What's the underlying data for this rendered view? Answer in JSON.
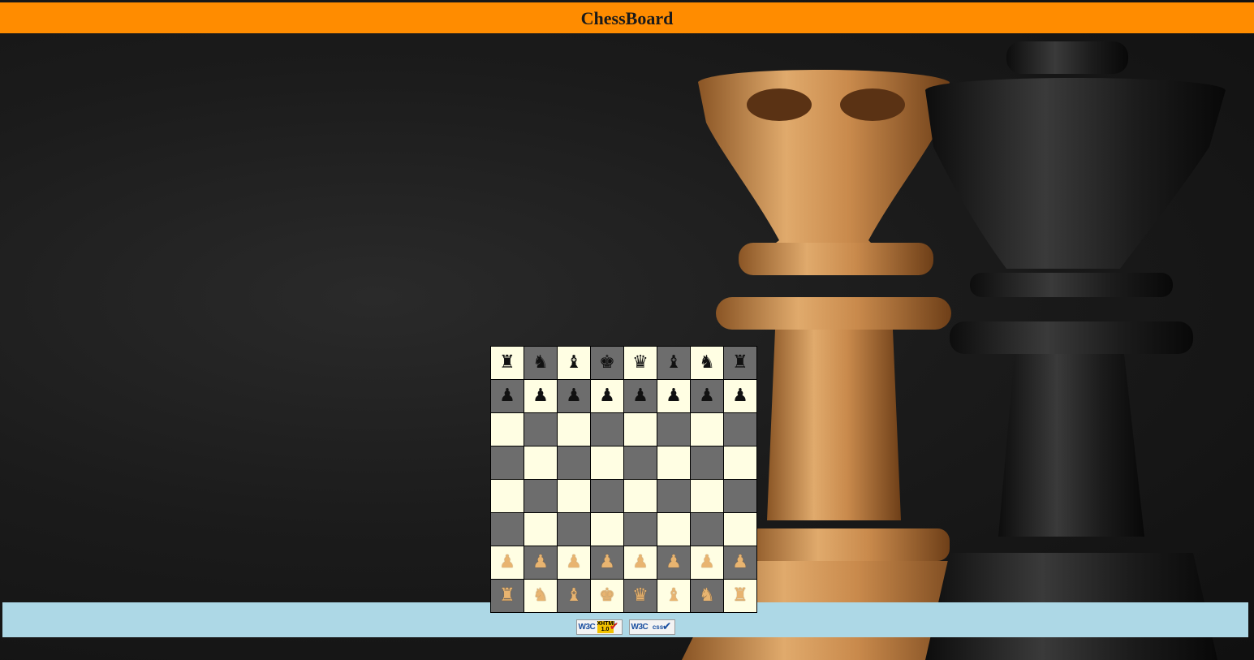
{
  "header": {
    "title": "ChessBoard"
  },
  "theme": {
    "header_bg": "#ff8c00",
    "footer_bg": "#add8e6",
    "light_square": "#fffee3",
    "dark_square": "#6d6d6d"
  },
  "board": {
    "rows": [
      [
        {
          "piece": "rook",
          "color": "black"
        },
        {
          "piece": "knight",
          "color": "black"
        },
        {
          "piece": "bishop",
          "color": "black"
        },
        {
          "piece": "king",
          "color": "black"
        },
        {
          "piece": "queen",
          "color": "black"
        },
        {
          "piece": "bishop",
          "color": "black"
        },
        {
          "piece": "knight",
          "color": "black"
        },
        {
          "piece": "rook",
          "color": "black"
        }
      ],
      [
        {
          "piece": "pawn",
          "color": "black"
        },
        {
          "piece": "pawn",
          "color": "black"
        },
        {
          "piece": "pawn",
          "color": "black"
        },
        {
          "piece": "pawn",
          "color": "black"
        },
        {
          "piece": "pawn",
          "color": "black"
        },
        {
          "piece": "pawn",
          "color": "black"
        },
        {
          "piece": "pawn",
          "color": "black"
        },
        {
          "piece": "pawn",
          "color": "black"
        }
      ],
      [
        null,
        null,
        null,
        null,
        null,
        null,
        null,
        null
      ],
      [
        null,
        null,
        null,
        null,
        null,
        null,
        null,
        null
      ],
      [
        null,
        null,
        null,
        null,
        null,
        null,
        null,
        null
      ],
      [
        null,
        null,
        null,
        null,
        null,
        null,
        null,
        null
      ],
      [
        {
          "piece": "pawn",
          "color": "white"
        },
        {
          "piece": "pawn",
          "color": "white"
        },
        {
          "piece": "pawn",
          "color": "white"
        },
        {
          "piece": "pawn",
          "color": "white"
        },
        {
          "piece": "pawn",
          "color": "white"
        },
        {
          "piece": "pawn",
          "color": "white"
        },
        {
          "piece": "pawn",
          "color": "white"
        },
        {
          "piece": "pawn",
          "color": "white"
        }
      ],
      [
        {
          "piece": "rook",
          "color": "white"
        },
        {
          "piece": "knight",
          "color": "white"
        },
        {
          "piece": "bishop",
          "color": "white"
        },
        {
          "piece": "king",
          "color": "white"
        },
        {
          "piece": "queen",
          "color": "white"
        },
        {
          "piece": "bishop",
          "color": "white"
        },
        {
          "piece": "knight",
          "color": "white"
        },
        {
          "piece": "rook",
          "color": "white"
        }
      ]
    ]
  },
  "footer": {
    "badges": [
      {
        "logo": "W3C",
        "tag": "XHTML 1.0",
        "icon": "checkmark-icon"
      },
      {
        "logo": "W3C",
        "tag": "css",
        "icon": "checkmark-icon"
      }
    ]
  }
}
